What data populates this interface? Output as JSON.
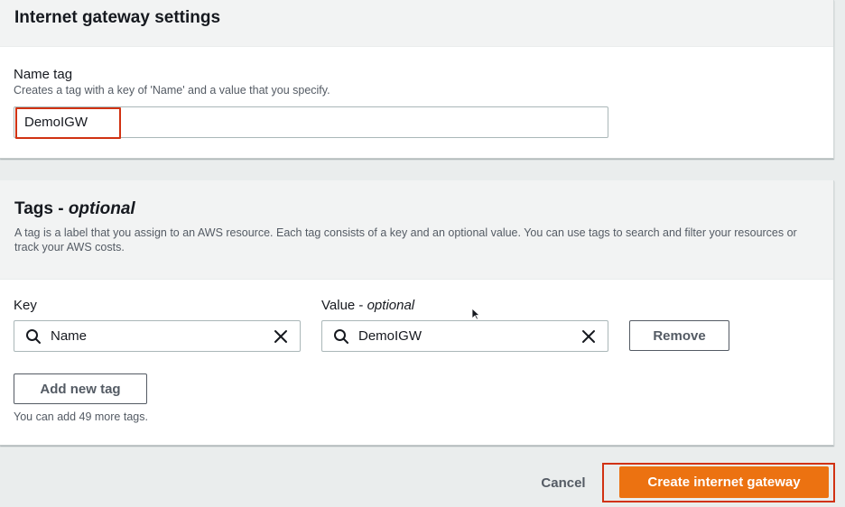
{
  "igw_section": {
    "title": "Internet gateway settings",
    "name_tag_label": "Name tag",
    "name_tag_desc": "Creates a tag with a key of 'Name' and a value that you specify.",
    "name_tag_value": "DemoIGW"
  },
  "tags_section": {
    "title_main": "Tags - ",
    "title_optional": "optional",
    "description": "A tag is a label that you assign to an AWS resource. Each tag consists of a key and an optional value. You can use tags to search and filter your resources or track your AWS costs.",
    "key_label": "Key",
    "value_label_main": "Value - ",
    "value_label_optional": "optional",
    "tag_key": "Name",
    "tag_value": "DemoIGW",
    "remove_label": "Remove",
    "add_tag_label": "Add new tag",
    "remaining_text": "You can add 49 more tags."
  },
  "footer": {
    "cancel_label": "Cancel",
    "create_label": "Create internet gateway"
  },
  "colors": {
    "primary": "#ec7211",
    "highlight": "#d13212",
    "header_bg": "#f2f3f3"
  },
  "icons": {
    "search": "search-icon",
    "clear": "close-icon"
  }
}
